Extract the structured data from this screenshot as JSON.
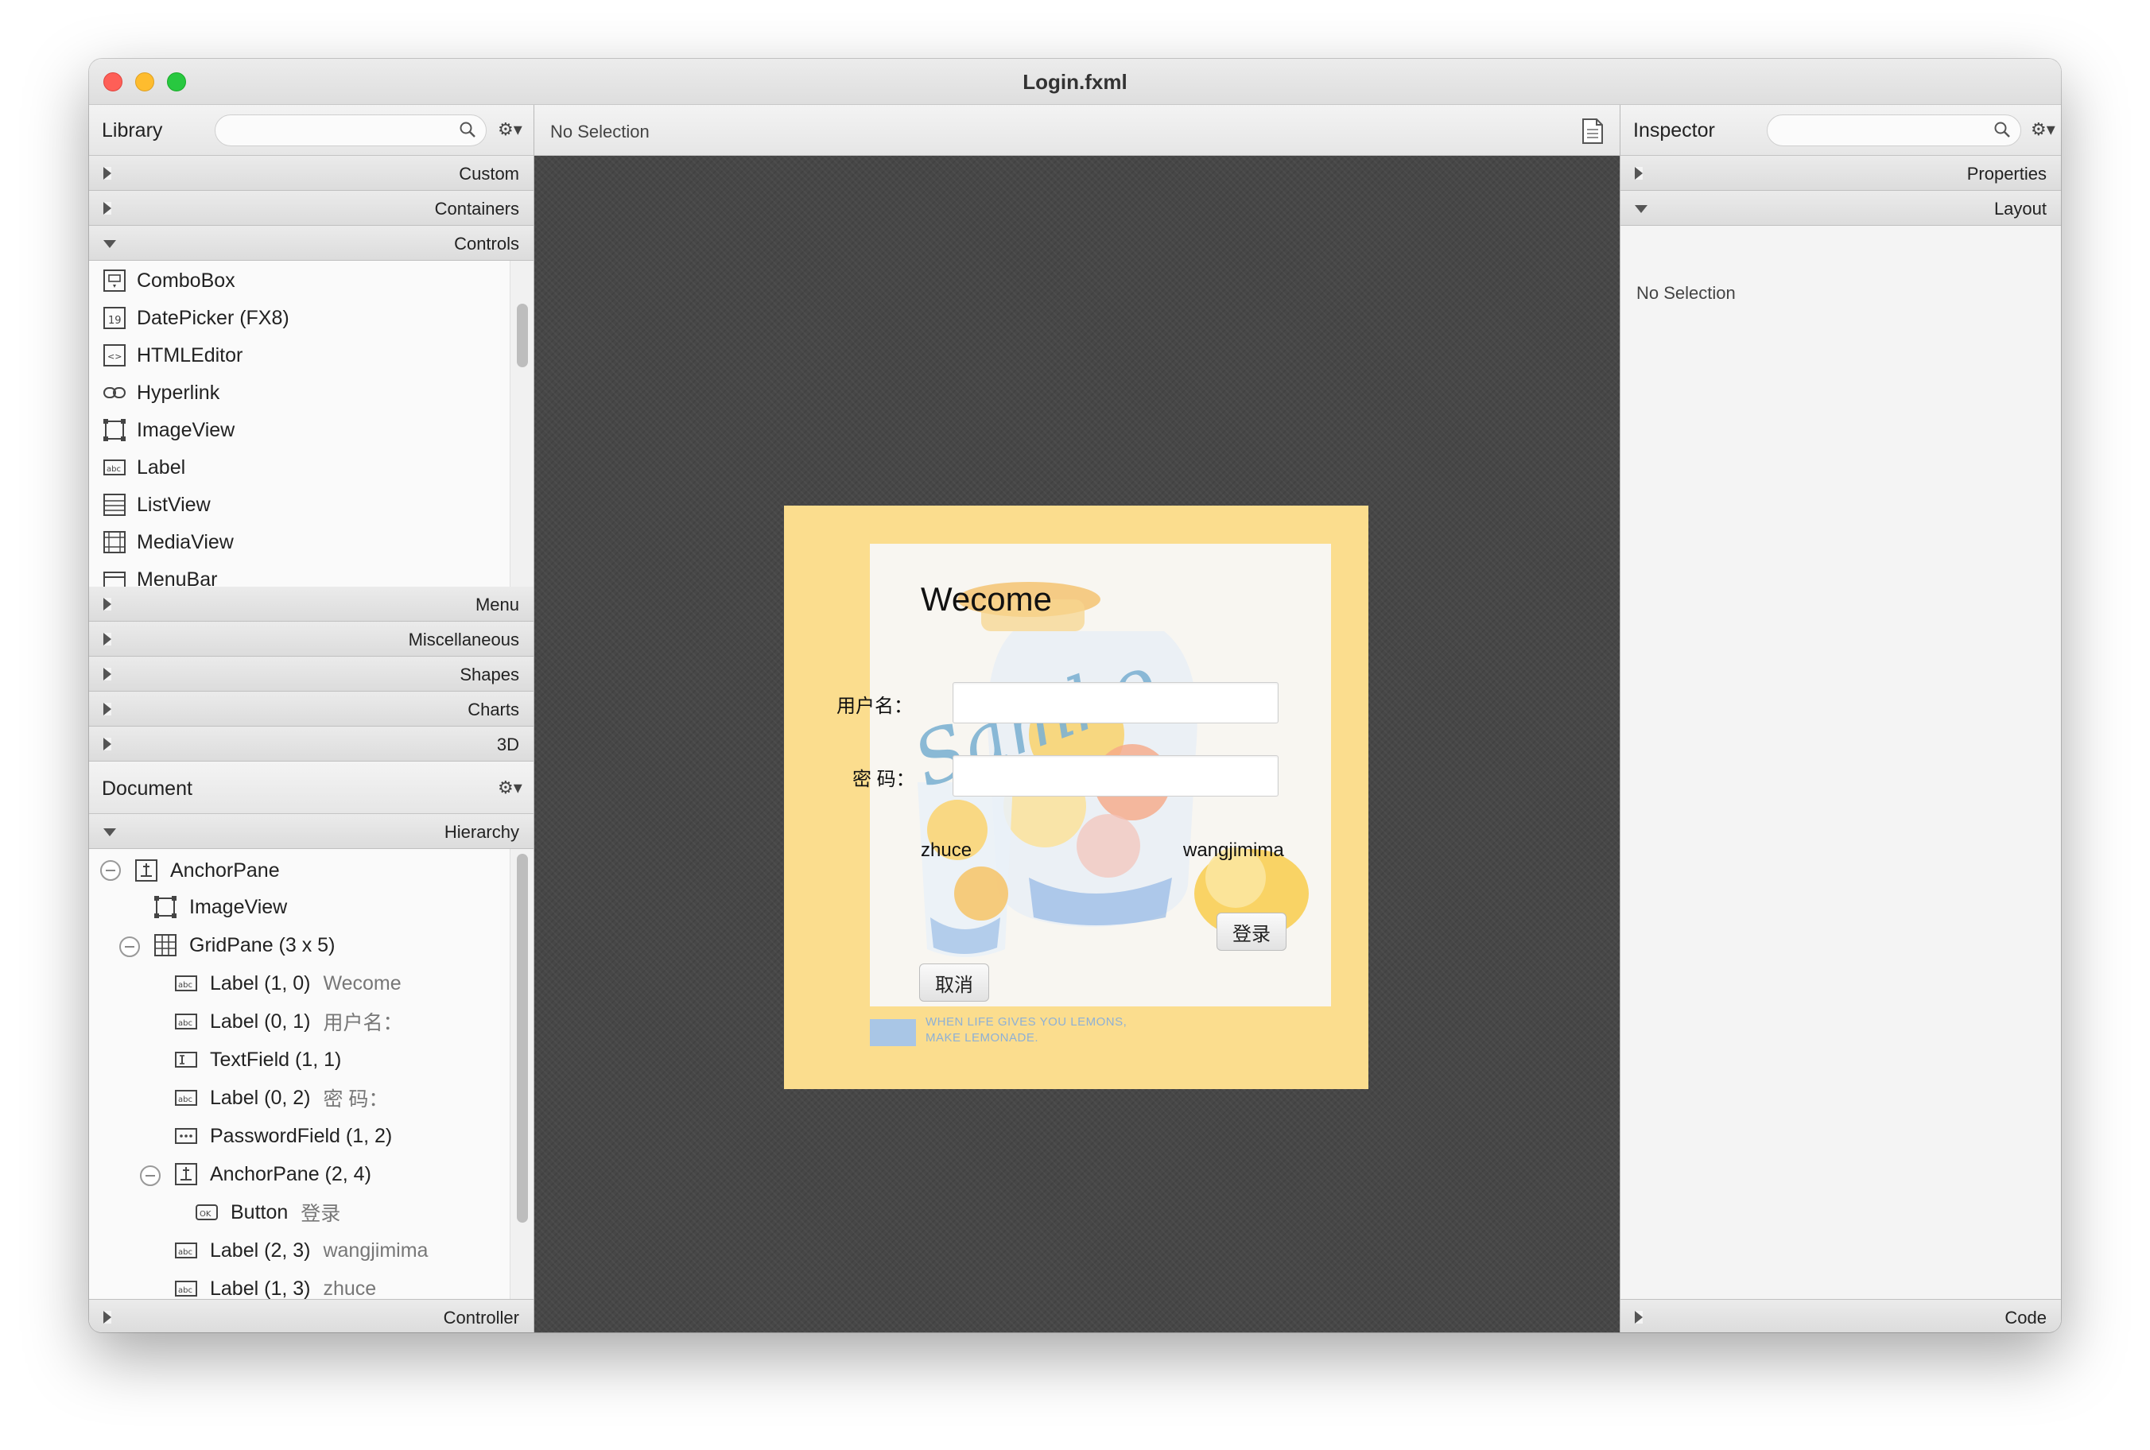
{
  "window": {
    "title": "Login.fxml"
  },
  "library": {
    "title": "Library",
    "sections_top": [
      "Custom",
      "Containers",
      "Controls"
    ],
    "controls": [
      "ComboBox",
      "DatePicker  (FX8)",
      "HTMLEditor",
      "Hyperlink",
      "ImageView",
      "Label",
      "ListView",
      "MediaView",
      "MenuBar"
    ],
    "sections_bottom": [
      "Menu",
      "Miscellaneous",
      "Shapes",
      "Charts",
      "3D"
    ]
  },
  "document": {
    "title": "Document",
    "hierarchy_label": "Hierarchy",
    "controller_label": "Controller",
    "tree": [
      {
        "type": "AnchorPane",
        "value": ""
      },
      {
        "type": "ImageView",
        "value": ""
      },
      {
        "type": "GridPane (3 x 5)",
        "value": ""
      },
      {
        "type": "Label (1, 0)",
        "value": "Wecome"
      },
      {
        "type": "Label (0, 1)",
        "value": "用户名："
      },
      {
        "type": "TextField (1, 1)",
        "value": ""
      },
      {
        "type": "Label (0, 2)",
        "value": "密 码："
      },
      {
        "type": "PasswordField (1, 2)",
        "value": ""
      },
      {
        "type": "AnchorPane (2, 4)",
        "value": ""
      },
      {
        "type": "Button",
        "value": "登录"
      },
      {
        "type": "Label (2, 3)",
        "value": "wangjimima"
      },
      {
        "type": "Label (1, 3)",
        "value": "zhuce"
      }
    ]
  },
  "center": {
    "selection": "No Selection"
  },
  "preview": {
    "welcome": "Wecome",
    "username_label": "用户名：",
    "password_label": "密 码：",
    "register": "zhuce",
    "forgot": "wangjimima",
    "login_button": "登录",
    "cancel_button": "取消",
    "signature": "Samko",
    "tagline_1": "WHEN LIFE GIVES YOU LEMONS,",
    "tagline_2": "MAKE LEMONADE."
  },
  "inspector": {
    "title": "Inspector",
    "sections": [
      "Properties",
      "Layout"
    ],
    "selection": "No Selection",
    "code_label": "Code"
  },
  "icons": [
    "search-icon",
    "gear-icon",
    "document-icon",
    "disclosure-triangle-icon"
  ],
  "colors": {
    "canvas": "#474747",
    "stage": "#fbdd8e",
    "accent_blue": "#7fb3d3"
  }
}
